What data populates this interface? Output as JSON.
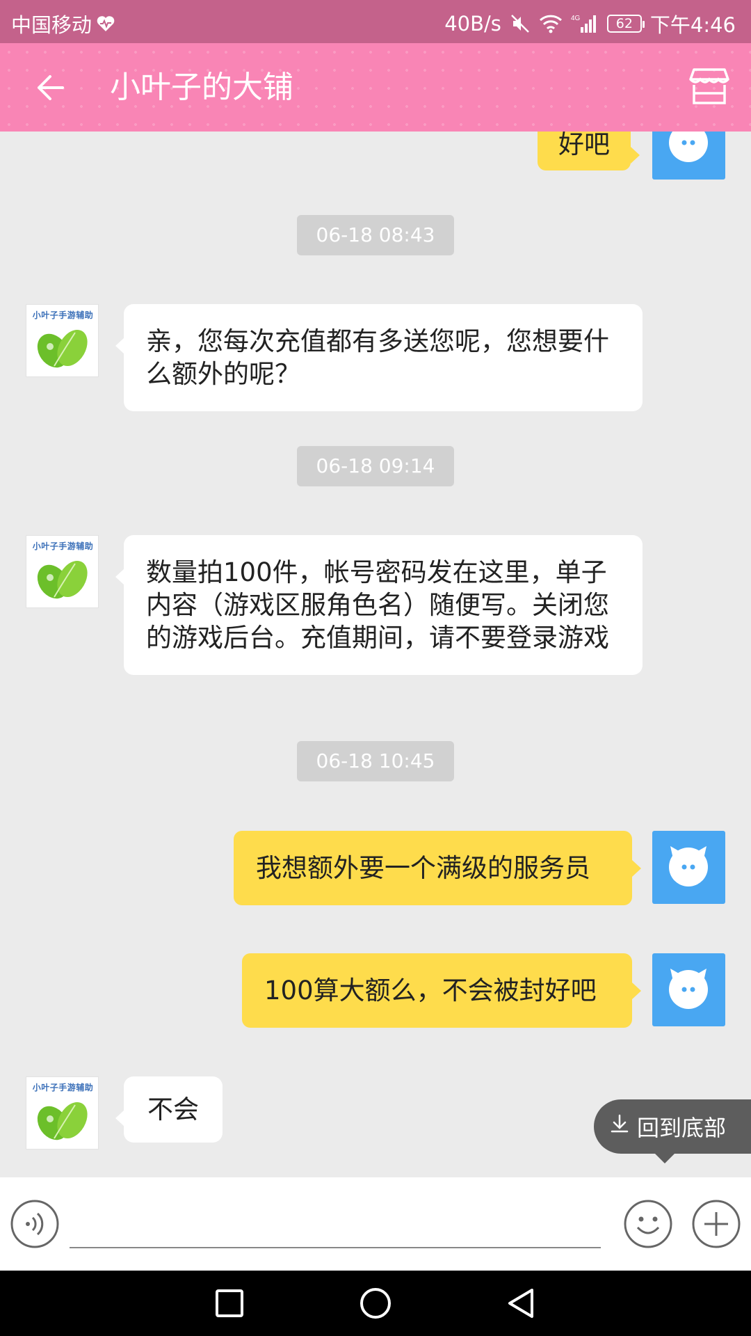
{
  "status_bar": {
    "carrier": "中国移动",
    "net_speed": "40B/s",
    "signal_type": "4G",
    "battery": "62",
    "time": "下午4:46"
  },
  "header": {
    "title": "小叶子的大铺",
    "back_icon": "arrow-left-icon",
    "shop_icon": "storefront-icon"
  },
  "chat": {
    "avatar_caption": "小叶子手游辅助",
    "messages": [
      {
        "side": "right",
        "text": "好吧"
      },
      {
        "type": "timestamp",
        "text": "06-18 08:43"
      },
      {
        "side": "left",
        "text": "亲，您每次充值都有多送您呢，您想要什么额外的呢？"
      },
      {
        "type": "timestamp",
        "text": "06-18 09:14"
      },
      {
        "side": "left",
        "text": "数量拍100件，帐号密码发在这里，单子内容（游戏区服角色名）随便写。关闭您的游戏后台。充值期间，请不要登录游戏"
      },
      {
        "type": "timestamp",
        "text": "06-18 10:45"
      },
      {
        "side": "right",
        "text": "我想额外要一个满级的服务员"
      },
      {
        "side": "right",
        "text": "100算大额么，不会被封好吧"
      },
      {
        "side": "left",
        "text": "不会"
      }
    ],
    "scroll_to_bottom_label": "回到底部"
  },
  "input_bar": {
    "voice_icon": "voice-icon",
    "emoji_icon": "emoji-icon",
    "plus_icon": "plus-icon",
    "value": ""
  },
  "colors": {
    "status_bar": "#c4628b",
    "header": "#f985b5",
    "chat_bg": "#ebebeb",
    "my_bubble": "#fedc4c",
    "my_avatar": "#49a7f2",
    "timestamp_bg": "#d1d1d1"
  }
}
